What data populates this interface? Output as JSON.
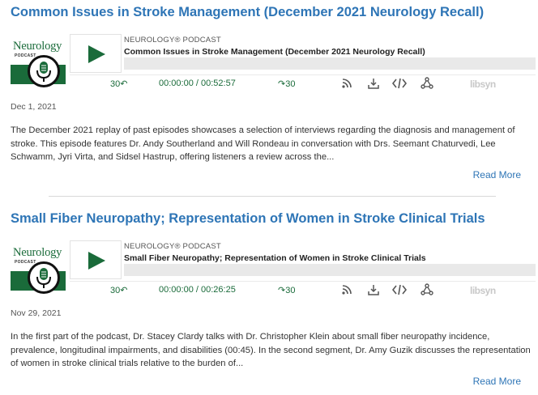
{
  "episodes": [
    {
      "title": "Common Issues in Stroke Management (December 2021 Neurology Recall)",
      "logo_text": "Neurology",
      "logo_sub": "PODCAST",
      "show_name": "NEUROLOGY® PODCAST",
      "episode_title": "Common Issues in Stroke Management (December 2021 Neurology Recall)",
      "rewind_label": "30↶",
      "time": "00:00:00 / 00:52:57",
      "forward_label": "↷30",
      "libsyn": "libsyn",
      "date": "Dec 1, 2021",
      "description": "The December 2021 replay of past episodes showcases a selection of interviews regarding the diagnosis and management of stroke. This episode features Dr. Andy Southerland and Will Rondeau in conversation with Drs. Seemant Chaturvedi, Lee Schwamm, Jyri Virta, and Sidsel Hastrup, offering listeners a review across the...",
      "read_more": "Read More",
      "progress": 0
    },
    {
      "title": "Small Fiber Neuropathy; Representation of Women in Stroke Clinical Trials",
      "logo_text": "Neurology",
      "logo_sub": "PODCAST",
      "show_name": "NEUROLOGY® PODCAST",
      "episode_title": "Small Fiber Neuropathy; Representation of Women in Stroke Clinical Trials",
      "rewind_label": "30↶",
      "time": "00:00:00 / 00:26:25",
      "forward_label": "↷30",
      "libsyn": "libsyn",
      "date": "Nov 29, 2021",
      "description": "In the first part of the podcast, Dr. Stacey Clardy talks with Dr. Christopher Klein about small fiber neuropathy incidence, prevalence, longitudinal impairments, and disabilities (00:45). In the second segment, Dr. Amy Guzik discusses the representation of women in stroke clinical trials relative to the burden of...",
      "read_more": "Read More",
      "progress": 0
    }
  ],
  "colors": {
    "title": "#2e75b6",
    "brand_green": "#1a6b3a",
    "link": "#2e75b6"
  },
  "icons": [
    "play-icon",
    "rewind-30-icon",
    "forward-30-icon",
    "rss-icon",
    "download-icon",
    "embed-code-icon",
    "share-icon",
    "libsyn-logo",
    "microphone-icon"
  ]
}
